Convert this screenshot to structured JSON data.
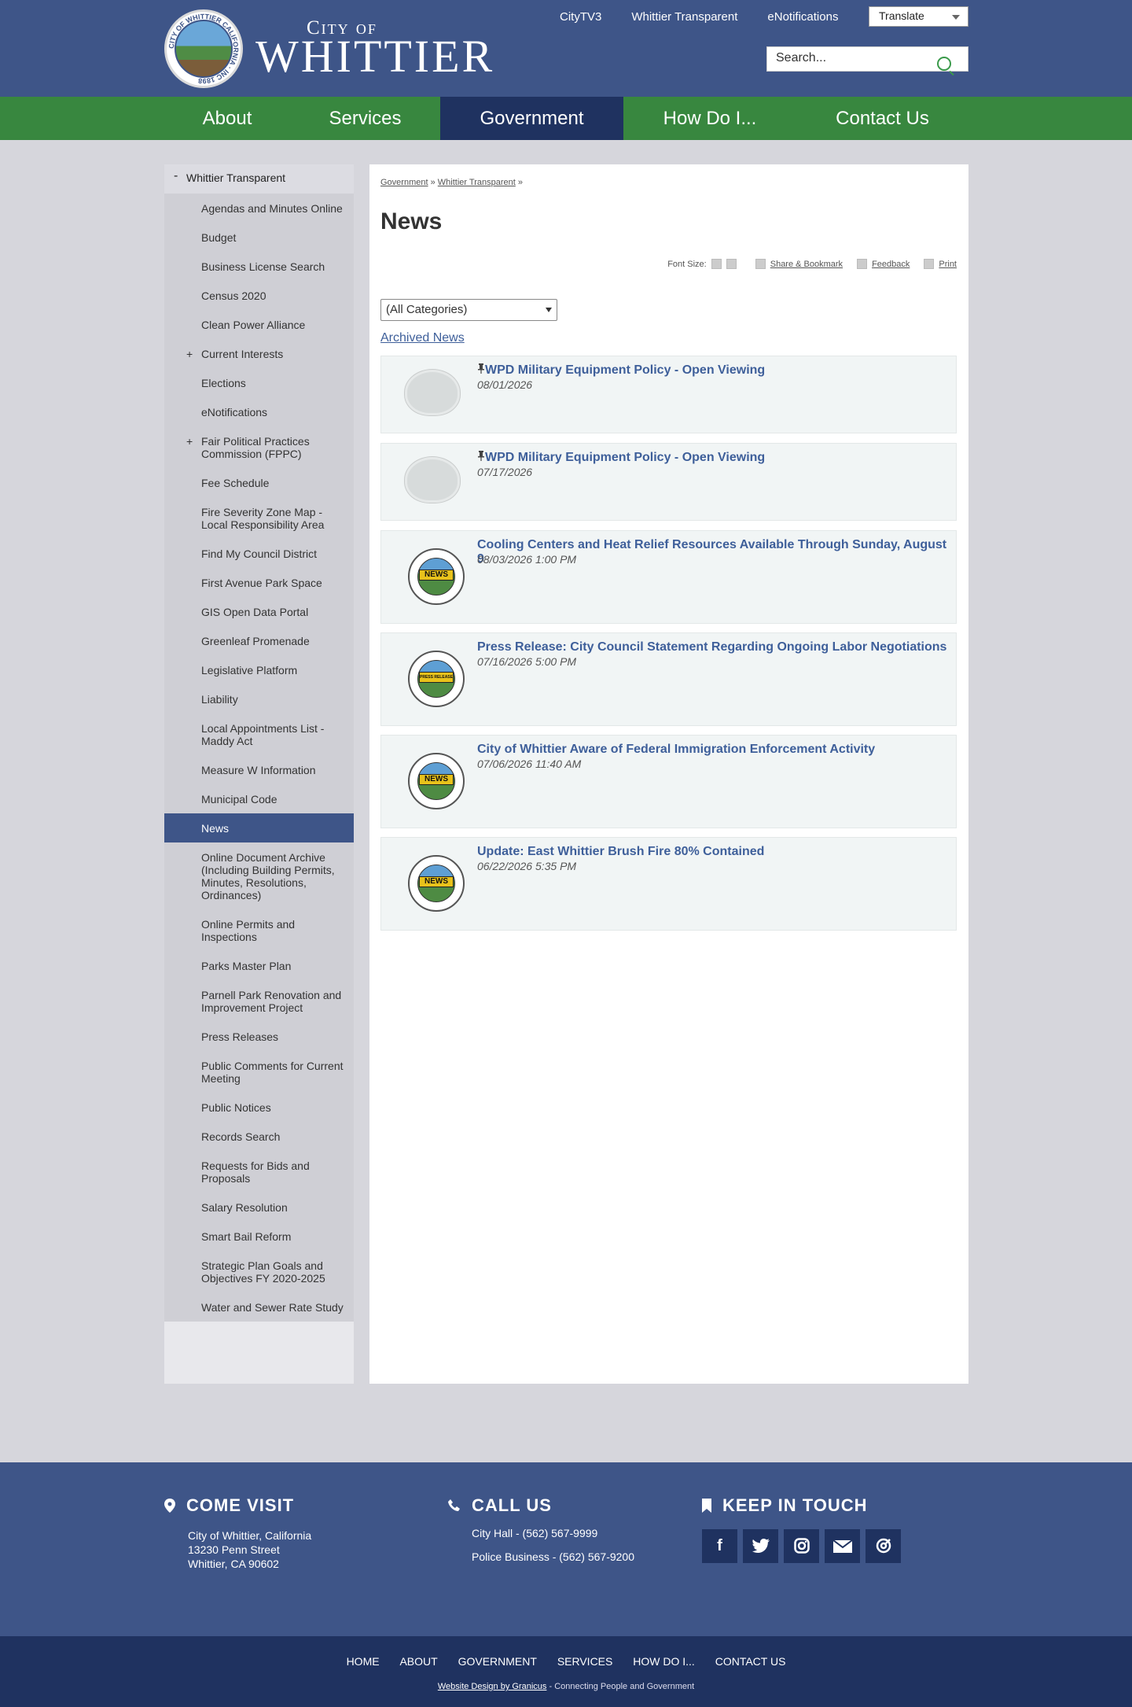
{
  "header": {
    "logo_small": "City of",
    "logo_name": "WHITTIER",
    "seal_text": "CITY OF WHITTIER CALIFORNIA · INC 1898",
    "top_links": [
      "CityTV3",
      "Whittier Transparent",
      "eNotifications"
    ],
    "translate_label": "Translate",
    "search_placeholder": "Search..."
  },
  "nav": {
    "items": [
      "About",
      "Services",
      "Government",
      "How Do I...",
      "Contact Us"
    ],
    "active": "Government"
  },
  "sidebar": {
    "heading": "Whittier Transparent",
    "heading_toggle": "-",
    "items": [
      "Agendas and Minutes Online",
      "Budget",
      "Business License Search",
      "Census 2020",
      "Clean Power Alliance",
      "Current Interests",
      "Elections",
      "eNotifications",
      "Fair Political Practices Commission (FPPC)",
      "Fee Schedule",
      "Fire Severity Zone Map - Local Responsibility Area",
      "Find My Council District",
      "First Avenue Park Space",
      "GIS Open Data Portal",
      "Greenleaf Promenade",
      "Legislative Platform",
      "Liability",
      "Local Appointments List - Maddy Act",
      "Measure W Information",
      "Municipal Code",
      "News",
      "Online Document Archive (Including Building Permits, Minutes, Resolutions, Ordinances)",
      "Online Permits and Inspections",
      "Parks Master Plan",
      "Parnell Park Renovation and Improvement Project",
      "Press Releases",
      "Public Comments for Current Meeting",
      "Public Notices",
      "Records Search",
      "Requests for Bids and Proposals",
      "Salary Resolution",
      "Smart Bail Reform",
      "Strategic Plan Goals and Objectives FY 2020-2025",
      "Water and Sewer Rate Study"
    ],
    "expandable_marker": "+",
    "active": "News"
  },
  "main": {
    "breadcrumb": [
      "Government",
      "Whittier Transparent"
    ],
    "breadcrumb_sep": "»",
    "title": "News",
    "tools": {
      "font_size": "Font Size:",
      "share": "Share & Bookmark",
      "feedback": "Feedback",
      "print": "Print"
    },
    "category_select": "(All Categories)",
    "archived_link": "Archived News",
    "news": [
      {
        "title": "WPD Military Equipment Policy - Open Viewing",
        "date": "08/01/2026",
        "pinned": true,
        "thumb": "police-badge"
      },
      {
        "title": "WPD Military Equipment Policy - Open Viewing",
        "date": "07/17/2026",
        "pinned": true,
        "thumb": "police-badge"
      },
      {
        "title": "Cooling Centers and Heat Relief Resources Available Through Sunday, August 9",
        "date": "08/03/2026 1:00 PM",
        "pinned": false,
        "thumb": "news-seal",
        "thumb_label": "NEWS"
      },
      {
        "title": "Press Release: City Council Statement Regarding Ongoing Labor Negotiations",
        "date": "07/16/2026 5:00 PM",
        "pinned": false,
        "thumb": "press-seal",
        "thumb_label": "PRESS RELEASE"
      },
      {
        "title": "City of Whittier Aware of Federal Immigration Enforcement Activity",
        "date": "07/06/2026 11:40 AM",
        "pinned": false,
        "thumb": "news-seal",
        "thumb_label": "NEWS"
      },
      {
        "title": "Update: East Whittier Brush Fire 80% Contained",
        "date": "06/22/2026 5:35 PM",
        "pinned": false,
        "thumb": "news-seal",
        "thumb_label": "NEWS"
      }
    ],
    "pin_glyph": "📍"
  },
  "footer": {
    "visit": {
      "heading": "COME VISIT",
      "lines": [
        "City of Whittier, California",
        "13230 Penn Street",
        "Whittier, CA 90602"
      ]
    },
    "call": {
      "heading": "CALL US",
      "lines": [
        "City Hall - (562) 567-9999",
        "Police Business - (562) 567-9200"
      ]
    },
    "touch": {
      "heading": "KEEP IN TOUCH",
      "social": [
        "facebook-icon",
        "twitter-icon",
        "instagram-icon",
        "email-icon",
        "threads-icon"
      ]
    },
    "bottom_links": [
      "HOME",
      "ABOUT",
      "GOVERNMENT",
      "SERVICES",
      "HOW DO I...",
      "CONTACT US"
    ],
    "credit_link": "Website Design by Granicus",
    "credit_text": " - Connecting People and Government"
  },
  "colors": {
    "header_blue": "#3e5588",
    "nav_green": "#38873f",
    "navy": "#1f3260",
    "link_blue": "#3e5f9a"
  }
}
